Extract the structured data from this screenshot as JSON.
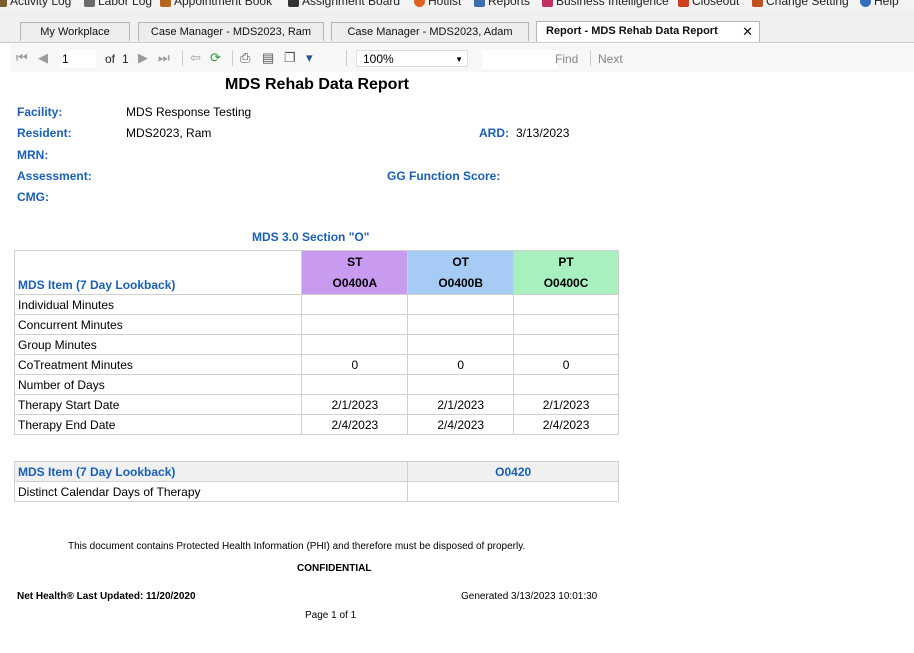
{
  "top_menu": [
    {
      "label": "Activity Log",
      "icon": "activity-log-icon",
      "color": "#7a5c2e"
    },
    {
      "label": "Labor Log",
      "icon": "labor-log-icon",
      "color": "#6b6b6b"
    },
    {
      "label": "Appointment Book",
      "icon": "appointment-book-icon",
      "color": "#b5651d"
    },
    {
      "label": "Assignment Board",
      "icon": "assignment-board-icon",
      "color": "#333333"
    },
    {
      "label": "Hotlist",
      "icon": "hotlist-icon",
      "color": "#e06020"
    },
    {
      "label": "Reports",
      "icon": "reports-icon",
      "color": "#3a6fb0"
    },
    {
      "label": "Business Intelligence",
      "icon": "business-intelligence-icon",
      "color": "#c03060"
    },
    {
      "label": "Closeout",
      "icon": "closeout-icon",
      "color": "#d04020"
    },
    {
      "label": "Change Setting",
      "icon": "change-setting-icon",
      "color": "#c05020"
    },
    {
      "label": "Help",
      "icon": "help-icon",
      "color": "#3070c0"
    }
  ],
  "tabs": [
    {
      "label": "My Workplace"
    },
    {
      "label": "Case Manager - MDS2023, Ram"
    },
    {
      "label": "Case Manager - MDS2023, Adam"
    },
    {
      "label": "Report - MDS Rehab Data Report"
    }
  ],
  "toolbar": {
    "page_value": "1",
    "of_text": "of",
    "page_total": "1",
    "zoom": "100%",
    "find_label": "Find",
    "next_label": "Next"
  },
  "report": {
    "title": "MDS Rehab Data Report",
    "facility_label": "Facility:",
    "facility_value": "MDS Response Testing",
    "resident_label": "Resident:",
    "resident_value": "MDS2023, Ram",
    "ard_label": "ARD:",
    "ard_value": "3/13/2023",
    "mrn_label": "MRN:",
    "assessment_label": "Assessment:",
    "gg_label": "GG Function Score:",
    "cmg_label": "CMG:",
    "section_title": "MDS 3.0 Section \"O\"",
    "table1": {
      "item_header": "MDS Item (7 Day Lookback)",
      "columns": [
        {
          "top": "ST",
          "code": "O0400A",
          "color": "#c89af0"
        },
        {
          "top": "OT",
          "code": "O0400B",
          "color": "#a6ccf5"
        },
        {
          "top": "PT",
          "code": "O0400C",
          "color": "#a8f0c0"
        }
      ],
      "rows": [
        {
          "label": "Individual Minutes",
          "values": [
            "",
            "",
            ""
          ]
        },
        {
          "label": "Concurrent Minutes",
          "values": [
            "",
            "",
            ""
          ]
        },
        {
          "label": "Group Minutes",
          "values": [
            "",
            "",
            ""
          ]
        },
        {
          "label": "CoTreatment Minutes",
          "values": [
            "0",
            "0",
            "0"
          ]
        },
        {
          "label": "Number of Days",
          "values": [
            "",
            "",
            ""
          ]
        },
        {
          "label": "Therapy Start Date",
          "values": [
            "2/1/2023",
            "2/1/2023",
            "2/1/2023"
          ]
        },
        {
          "label": "Therapy End Date",
          "values": [
            "2/4/2023",
            "2/4/2023",
            "2/4/2023"
          ]
        }
      ]
    },
    "table2": {
      "item_header": "MDS Item (7 Day Lookback)",
      "code": "O0420",
      "row_label": "Distinct Calendar Days of Therapy",
      "row_value": ""
    },
    "phi_note": "This document contains Protected Health Information (PHI) and therefore must be disposed of properly.",
    "confidential": "CONFIDENTIAL",
    "last_updated": "Net Health® Last Updated: 11/20/2020",
    "generated": "Generated 3/13/2023 10:01:30",
    "page_label": "Page 1 of 1"
  }
}
